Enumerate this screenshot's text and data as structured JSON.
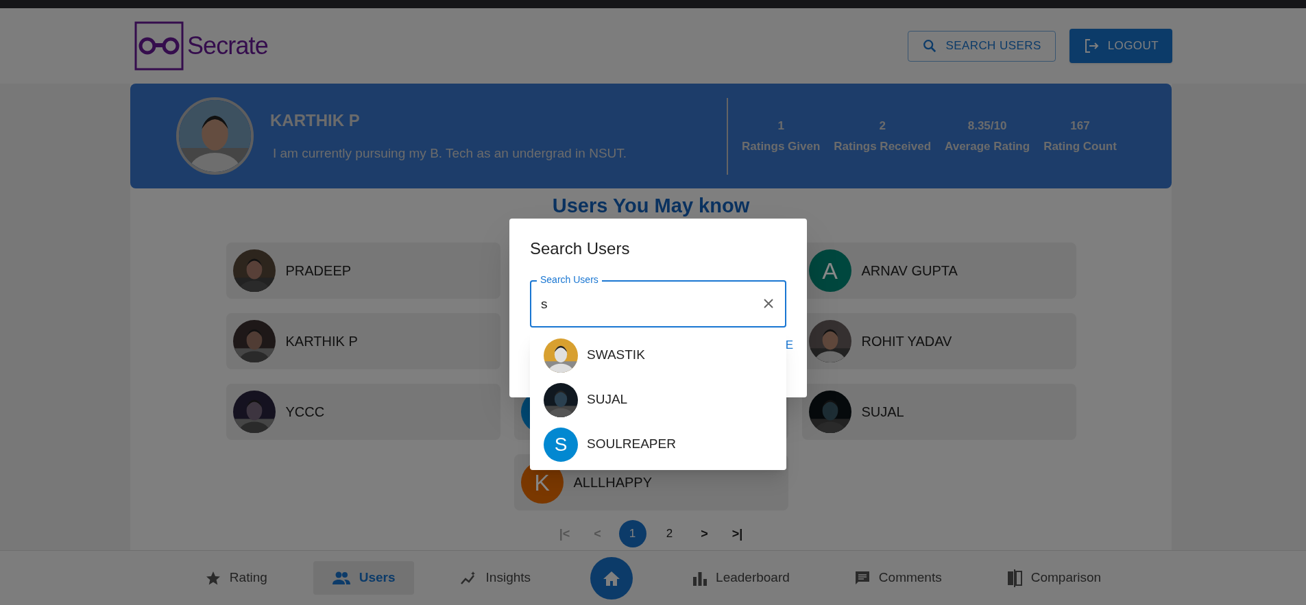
{
  "header": {
    "logo_text": "Secrate",
    "buttons": [
      {
        "kind": "outlined",
        "label": "SEARCH USERS"
      },
      {
        "kind": "contained",
        "label": "LOGOUT"
      }
    ]
  },
  "profile": {
    "name": "KARTHIK P",
    "bio": "I am currently pursuing my B. Tech as an undergrad in NSUT.",
    "stats": [
      {
        "value": "1",
        "label": "Ratings Given"
      },
      {
        "value": "2",
        "label": "Ratings Received"
      },
      {
        "value": "8.35/10",
        "label": "Average Rating"
      },
      {
        "value": "167",
        "label": "Rating Count"
      }
    ]
  },
  "users_section": {
    "title": "Users You May know",
    "cards": [
      {
        "name": "PRADEEP"
      },
      {
        "avatar": {
          "kind": "hidden"
        }
      },
      {
        "name": "ARNAV GUPTA",
        "avatar": {
          "kind": "letter",
          "letter": "A",
          "color": "#00473e"
        }
      },
      {
        "name": "KARTHIK P"
      },
      {
        "avatar": {
          "kind": "hidden"
        }
      },
      {
        "name": "ROHIT YADAV"
      },
      {
        "name": "YCCC"
      },
      {
        "avatar": {
          "kind": "letter",
          "color": "#014a75"
        }
      },
      {
        "name": "SUJAL"
      },
      {
        "avatar": {
          "kind": "none"
        }
      },
      {
        "name": "ALLLHAPPY",
        "avatar": {
          "kind": "letter",
          "letter": "K",
          "color": "#7a3800"
        }
      }
    ],
    "pagination": [
      {
        "kind": "first",
        "label": "|<",
        "disabled": true
      },
      {
        "kind": "prev",
        "label": "<",
        "disabled": true
      },
      {
        "kind": "page",
        "label": "1",
        "selected": true
      },
      {
        "kind": "page",
        "label": "2",
        "selected": false
      },
      {
        "kind": "next",
        "label": ">",
        "disabled": false
      },
      {
        "kind": "last",
        "label": ">|",
        "disabled": false
      }
    ]
  },
  "bottom_nav": [
    {
      "kind": "star",
      "label": "Rating",
      "selected": false
    },
    {
      "kind": "users",
      "label": "Users",
      "selected": true
    },
    {
      "kind": "insights",
      "label": "Insights",
      "selected": false
    },
    {
      "kind": "home",
      "selected": false
    },
    {
      "kind": "chart",
      "label": "Leaderboard",
      "selected": false
    },
    {
      "kind": "comment",
      "label": "Comments",
      "selected": false
    },
    {
      "kind": "compare",
      "label": "Comparison",
      "selected": false
    }
  ],
  "dialog": {
    "title": "Search Users",
    "field": {
      "label": "Search Users",
      "value": "s"
    },
    "action": "E",
    "results": [
      {
        "name": "SWASTIK"
      },
      {
        "name": "SUJAL"
      },
      {
        "name": "SOULREAPER",
        "avatar": {
          "kind": "letter",
          "letter": "S",
          "color": "#0288d1"
        }
      }
    ]
  }
}
